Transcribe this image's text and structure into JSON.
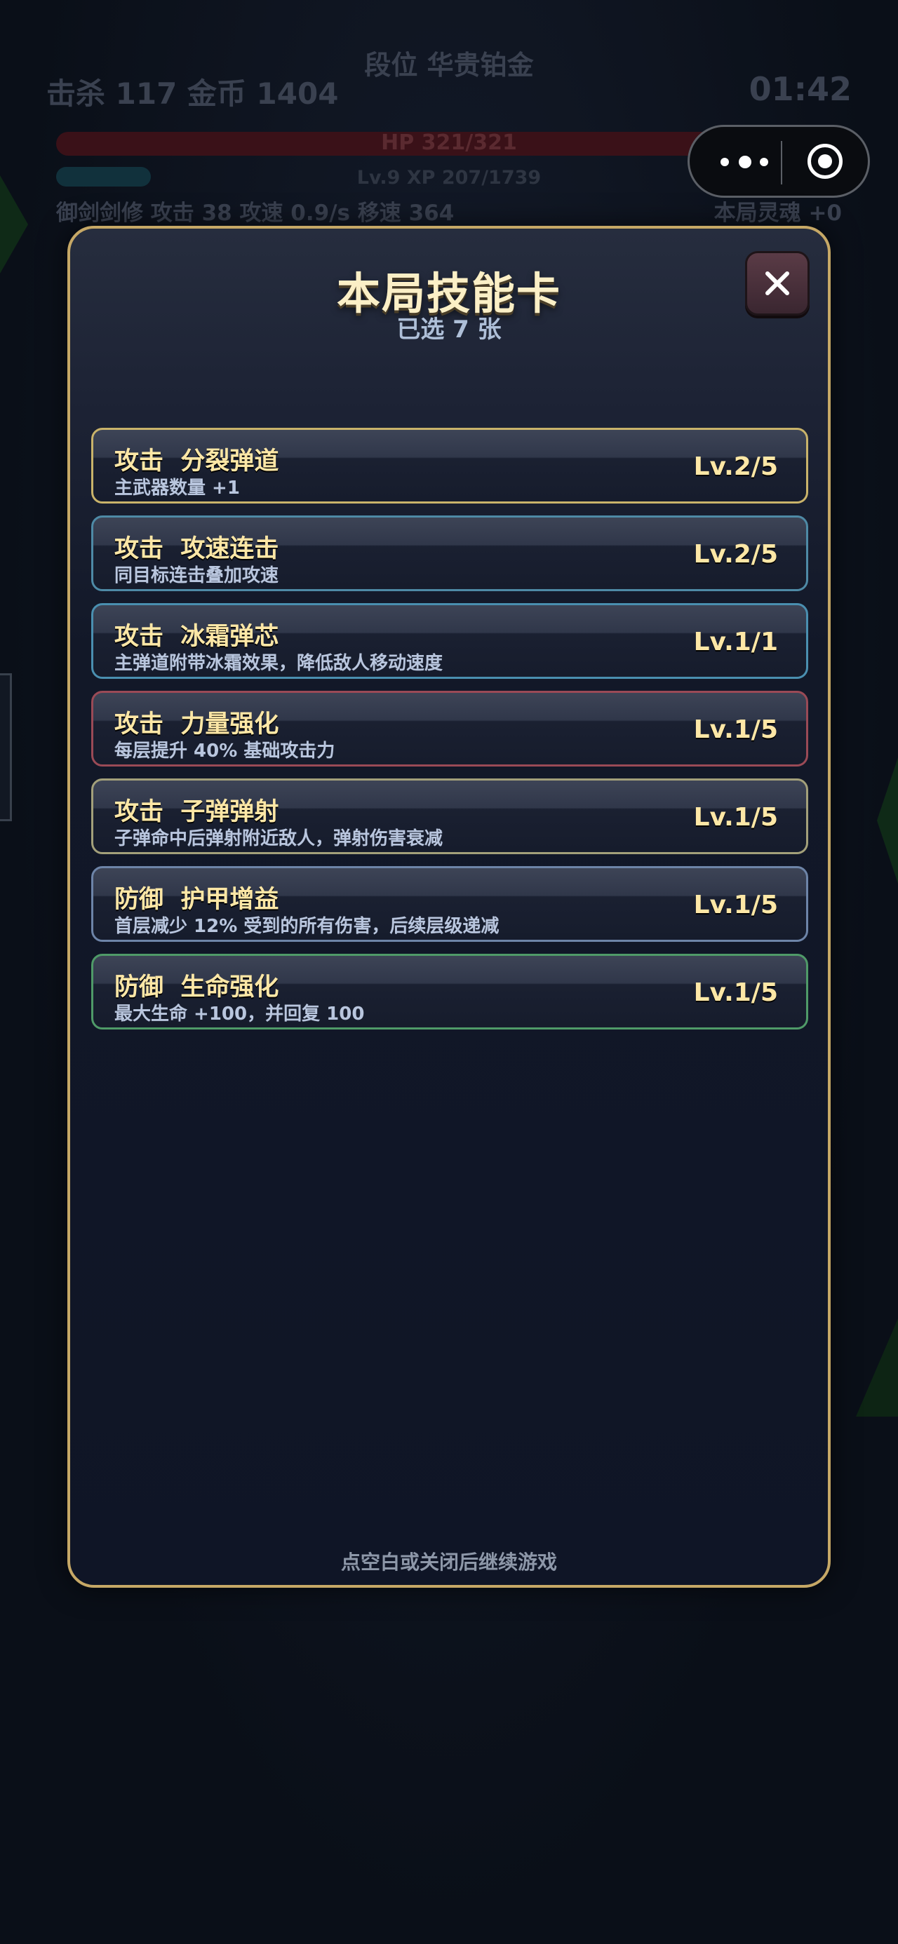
{
  "hud": {
    "rank": "段位 华贵铂金",
    "stats": "击杀 117  金币 1404",
    "timer": "01:42",
    "hp": "HP 321/321",
    "xp": "Lv.9  XP 207/1739",
    "skills": "御剑剑修  攻击 38  攻速 0.9/s  移速 364",
    "soul": "本局灵魂 +0"
  },
  "modal": {
    "title": "本局技能卡",
    "subtitle": "已选 7 张",
    "close_icon": "close-icon",
    "footer": "点空白或关闭后继续游戏"
  },
  "skills": [
    {
      "name": "攻击  分裂弹道",
      "desc": "主武器数量 +1",
      "level": "Lv.2/5",
      "border": "#c9b36a"
    },
    {
      "name": "攻击  攻速连击",
      "desc": "同目标连击叠加攻速",
      "level": "Lv.2/5",
      "border": "#4e8aa6"
    },
    {
      "name": "攻击  冰霜弹芯",
      "desc": "主弹道附带冰霜效果，降低敌人移动速度",
      "level": "Lv.1/1",
      "border": "#4a8fb0"
    },
    {
      "name": "攻击  力量强化",
      "desc": "每层提升 40% 基础攻击力",
      "level": "Lv.1/5",
      "border": "#9a4a56"
    },
    {
      "name": "攻击  子弹弹射",
      "desc": "子弹命中后弹射附近敌人，弹射伤害衰减",
      "level": "Lv.1/5",
      "border": "#a3a07a"
    },
    {
      "name": "防御  护甲增益",
      "desc": "首层减少 12% 受到的所有伤害，后续层级递减",
      "level": "Lv.1/5",
      "border": "#6d84a8"
    },
    {
      "name": "防御  生命强化",
      "desc": "最大生命 +100，并回复 100",
      "level": "Lv.1/5",
      "border": "#4f9a68"
    }
  ]
}
